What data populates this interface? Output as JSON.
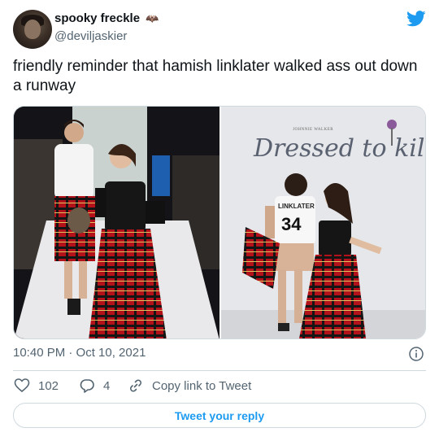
{
  "user": {
    "name": "spooky freckle",
    "handle": "@deviljaskier",
    "name_emoji_icon": "bat-icon"
  },
  "tweet": {
    "text": "friendly reminder that hamish linklater walked ass out down a runway",
    "timestamp": "10:40 PM · Oct 10, 2021"
  },
  "media": {
    "right_backdrop": "Dressed to kilt",
    "right_backdrop_small": "JOHNNIE WALKER",
    "jersey_name": "LINKLATER",
    "jersey_number": "34"
  },
  "actions": {
    "like_count": "102",
    "reply_count": "4",
    "copy_link_label": "Copy link to Tweet"
  },
  "reply_button_label": "Tweet your reply",
  "colors": {
    "accent": "#1d9bf0",
    "text": "#0f1419",
    "muted": "#536471",
    "border": "#cfd9de"
  }
}
